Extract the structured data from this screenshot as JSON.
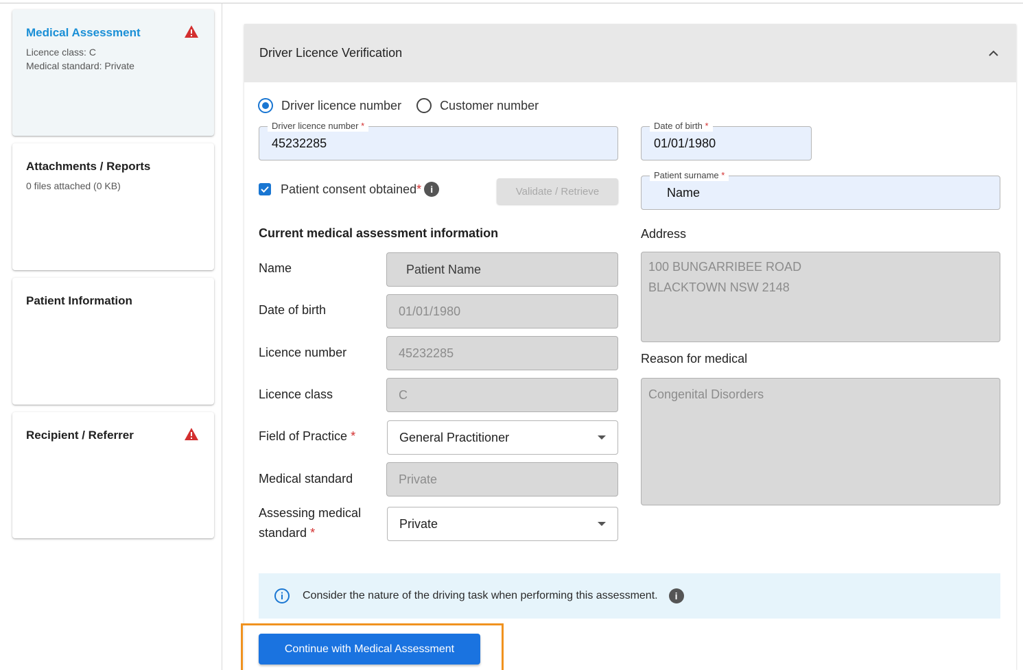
{
  "sidebar": {
    "items": [
      {
        "title": "Medical Assessment",
        "lines": [
          "Licence class: C",
          "Medical standard: Private"
        ],
        "warning": true,
        "active": true
      },
      {
        "title": "Attachments / Reports",
        "lines": [
          "0 files attached (0 KB)"
        ],
        "warning": false,
        "active": false
      },
      {
        "title": "Patient Information",
        "lines": [],
        "warning": false,
        "active": false
      },
      {
        "title": "Recipient / Referrer",
        "lines": [],
        "warning": true,
        "active": false
      }
    ]
  },
  "panel": {
    "title": "Driver Licence Verification",
    "radio": {
      "options": [
        "Driver licence number",
        "Customer number"
      ],
      "selected": "Driver licence number"
    },
    "licence_field": {
      "label": "Driver licence number",
      "value": "45232285"
    },
    "dob_field": {
      "label": "Date of birth",
      "value": "01/01/1980"
    },
    "surname_field": {
      "label": "Patient surname",
      "value": "Name"
    },
    "consent_label": "Patient consent obtained",
    "consent_checked": true,
    "validate_button": "Validate / Retrieve",
    "section_title": "Current medical assessment information",
    "rows": {
      "name": {
        "label": "Name",
        "value": "Patient Name"
      },
      "dob": {
        "label": "Date of birth",
        "value": "01/01/1980"
      },
      "licence_number": {
        "label": "Licence number",
        "value": "45232285"
      },
      "licence_class": {
        "label": "Licence class",
        "value": "C"
      },
      "field_of_practice": {
        "label": "Field of Practice",
        "value": "General Practitioner"
      },
      "medical_standard": {
        "label": "Medical standard",
        "value": "Private"
      },
      "assessing_standard": {
        "label_line1": "Assessing medical",
        "label_line2": "standard",
        "value": "Private"
      }
    },
    "address": {
      "label": "Address",
      "line1": "100 BUNGARRIBEE ROAD",
      "line2": "BLACKTOWN NSW 2148"
    },
    "reason": {
      "label": "Reason for medical",
      "value": "Congenital Disorders"
    },
    "info_banner": "Consider the nature of the driving task when performing this assessment.",
    "continue_button": "Continue with Medical Assessment"
  },
  "colors": {
    "accent": "#1a73e0",
    "active_title": "#1a8fd6",
    "warning": "#d32f2f",
    "highlight": "#f0921f"
  }
}
